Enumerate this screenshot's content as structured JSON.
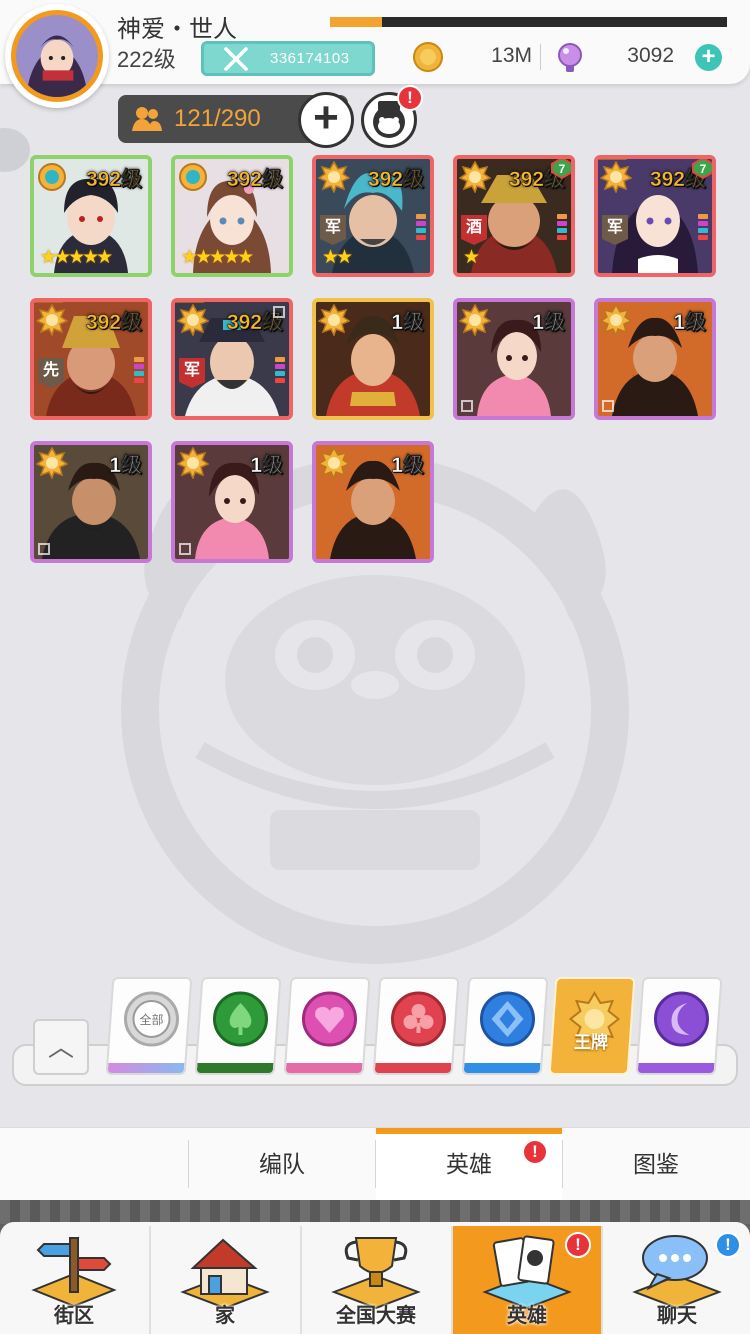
{
  "player": {
    "name": "神爱・世人",
    "level": "222级",
    "id": "336174103",
    "exp_fraction": 0.13
  },
  "currency": {
    "coins": "13M",
    "gems": "3092"
  },
  "hero_count": "121/290",
  "heroes": [
    {
      "level": "392级",
      "frame": "green",
      "stars": "★★★★★",
      "tag": ""
    },
    {
      "level": "392级",
      "frame": "green",
      "stars": "★★★★★",
      "tag": ""
    },
    {
      "level": "392级",
      "frame": "red",
      "stars": "★★",
      "tag": "军"
    },
    {
      "level": "392级",
      "frame": "red",
      "stars": "★",
      "tag": "酒"
    },
    {
      "level": "392级",
      "frame": "red",
      "stars": "",
      "tag": "军"
    },
    {
      "level": "392级",
      "frame": "red",
      "stars": "",
      "tag": "先"
    },
    {
      "level": "392级",
      "frame": "red",
      "stars": "",
      "tag": "军"
    },
    {
      "level": "1级",
      "frame": "gold",
      "stars": "",
      "tag": ""
    },
    {
      "level": "1级",
      "frame": "purple",
      "stars": "",
      "tag": ""
    },
    {
      "level": "1级",
      "frame": "purple",
      "stars": "",
      "tag": ""
    },
    {
      "level": "1级",
      "frame": "purple",
      "stars": "",
      "tag": ""
    },
    {
      "level": "1级",
      "frame": "purple",
      "stars": "",
      "tag": ""
    },
    {
      "level": "1级",
      "frame": "purple",
      "stars": "",
      "tag": ""
    }
  ],
  "filters": {
    "all_emblem_text": "全部",
    "active_label": "王牌"
  },
  "subtabs": [
    "编队",
    "英雄",
    "图鉴"
  ],
  "nav": [
    "街区",
    "家",
    "全国大赛",
    "英雄",
    "聊天"
  ],
  "notifications": {
    "red": "!",
    "blue": "!"
  },
  "colors": {
    "accent": "#f39a1e",
    "teal": "#3ec4b6",
    "spade": "#3aa53a",
    "heart": "#e04fb6",
    "club": "#e0434f",
    "diamond": "#2f7fe0",
    "sun": "#f3b23a",
    "moon": "#8b4fd6"
  }
}
